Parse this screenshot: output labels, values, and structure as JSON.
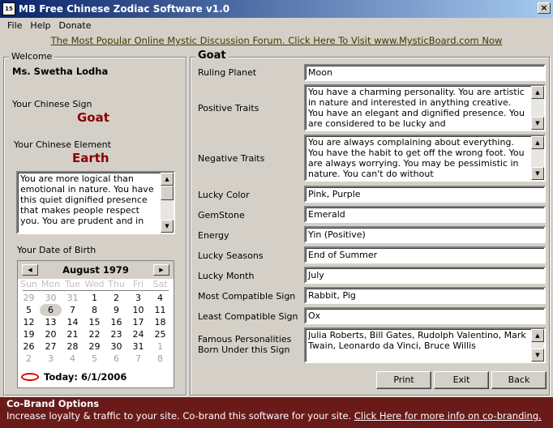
{
  "window": {
    "title": "MB Free Chinese Zodiac Software v1.0",
    "icon_text": "15",
    "close_glyph": "×"
  },
  "menu": [
    "File",
    "Help",
    "Donate"
  ],
  "promo": "The Most Popular Online Mystic Discussion Forum. Click Here To Visit www.MysticBoard.com Now",
  "left": {
    "group_title": "Welcome",
    "user_name": "Ms. Swetha Lodha",
    "sign_label": "Your Chinese Sign",
    "sign_value": "Goat",
    "element_label": "Your Chinese Element",
    "element_value": "Earth",
    "element_desc": "You are more logical than emotional in nature. You have this quiet dignified presence that makes people respect you. You are prudent and in",
    "dob_label": "Your Date of Birth"
  },
  "calendar": {
    "month": "August 1979",
    "dow": [
      "Sun",
      "Mon",
      "Tue",
      "Wed",
      "Thu",
      "Fri",
      "Sat"
    ],
    "weeks": [
      [
        "29",
        "30",
        "31",
        "1",
        "2",
        "3",
        "4"
      ],
      [
        "5",
        "6",
        "7",
        "8",
        "9",
        "10",
        "11"
      ],
      [
        "12",
        "13",
        "14",
        "15",
        "16",
        "17",
        "18"
      ],
      [
        "19",
        "20",
        "21",
        "22",
        "23",
        "24",
        "25"
      ],
      [
        "26",
        "27",
        "28",
        "29",
        "30",
        "31",
        "1"
      ],
      [
        "2",
        "3",
        "4",
        "5",
        "6",
        "7",
        "8"
      ]
    ],
    "today": "Today: 6/1/2006"
  },
  "right": {
    "group_title": "Goat",
    "ruling_planet_label": "Ruling Planet",
    "ruling_planet": "Moon",
    "positive_label": "Positive Traits",
    "positive": "You have a charming personality. You are artistic in nature and interested in anything creative. You have an elegant and dignified presence. You are considered to be lucky and",
    "negative_label": "Negative Traits",
    "negative": "You are always complaining about everything. You have the habit to get off the wrong foot. You are always worrying. You may be pessimistic in nature. You can't do without",
    "lucky_color_label": "Lucky Color",
    "lucky_color": "Pink, Purple",
    "gemstone_label": "GemStone",
    "gemstone": "Emerald",
    "energy_label": "Energy",
    "energy": "Yin (Positive)",
    "lucky_seasons_label": "Lucky Seasons",
    "lucky_seasons": "End of Summer",
    "lucky_month_label": "Lucky Month",
    "lucky_month": "July",
    "most_compat_label": "Most Compatible Sign",
    "most_compat": "Rabbit, Pig",
    "least_compat_label": "Least Compatible Sign",
    "least_compat": "Ox",
    "famous_label": "Famous Personalities Born Under this Sign",
    "famous": "Julia Roberts, Bill Gates, Rudolph Valentino, Mark Twain, Leonardo da Vinci, Bruce Willis"
  },
  "buttons": {
    "print": "Print",
    "exit": "Exit",
    "back": "Back"
  },
  "cobrand": {
    "title": "Co-Brand Options",
    "text": "Increase loyalty & traffic to your site. Co-brand this software for your site.",
    "link": "Click Here for more info on co-branding."
  },
  "scroll": {
    "up": "▲",
    "down": "▼",
    "left": "◀",
    "right": "▶"
  }
}
